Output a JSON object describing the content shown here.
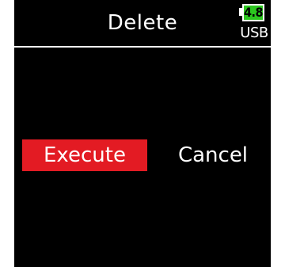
{
  "header": {
    "title": "Delete"
  },
  "status": {
    "battery_level": "4.8",
    "power_source": "USB",
    "battery_color": "#2cc61f"
  },
  "dialog": {
    "options": [
      {
        "label": "Execute",
        "selected": true
      },
      {
        "label": "Cancel",
        "selected": false
      }
    ],
    "selected_color": "#e31b23"
  }
}
